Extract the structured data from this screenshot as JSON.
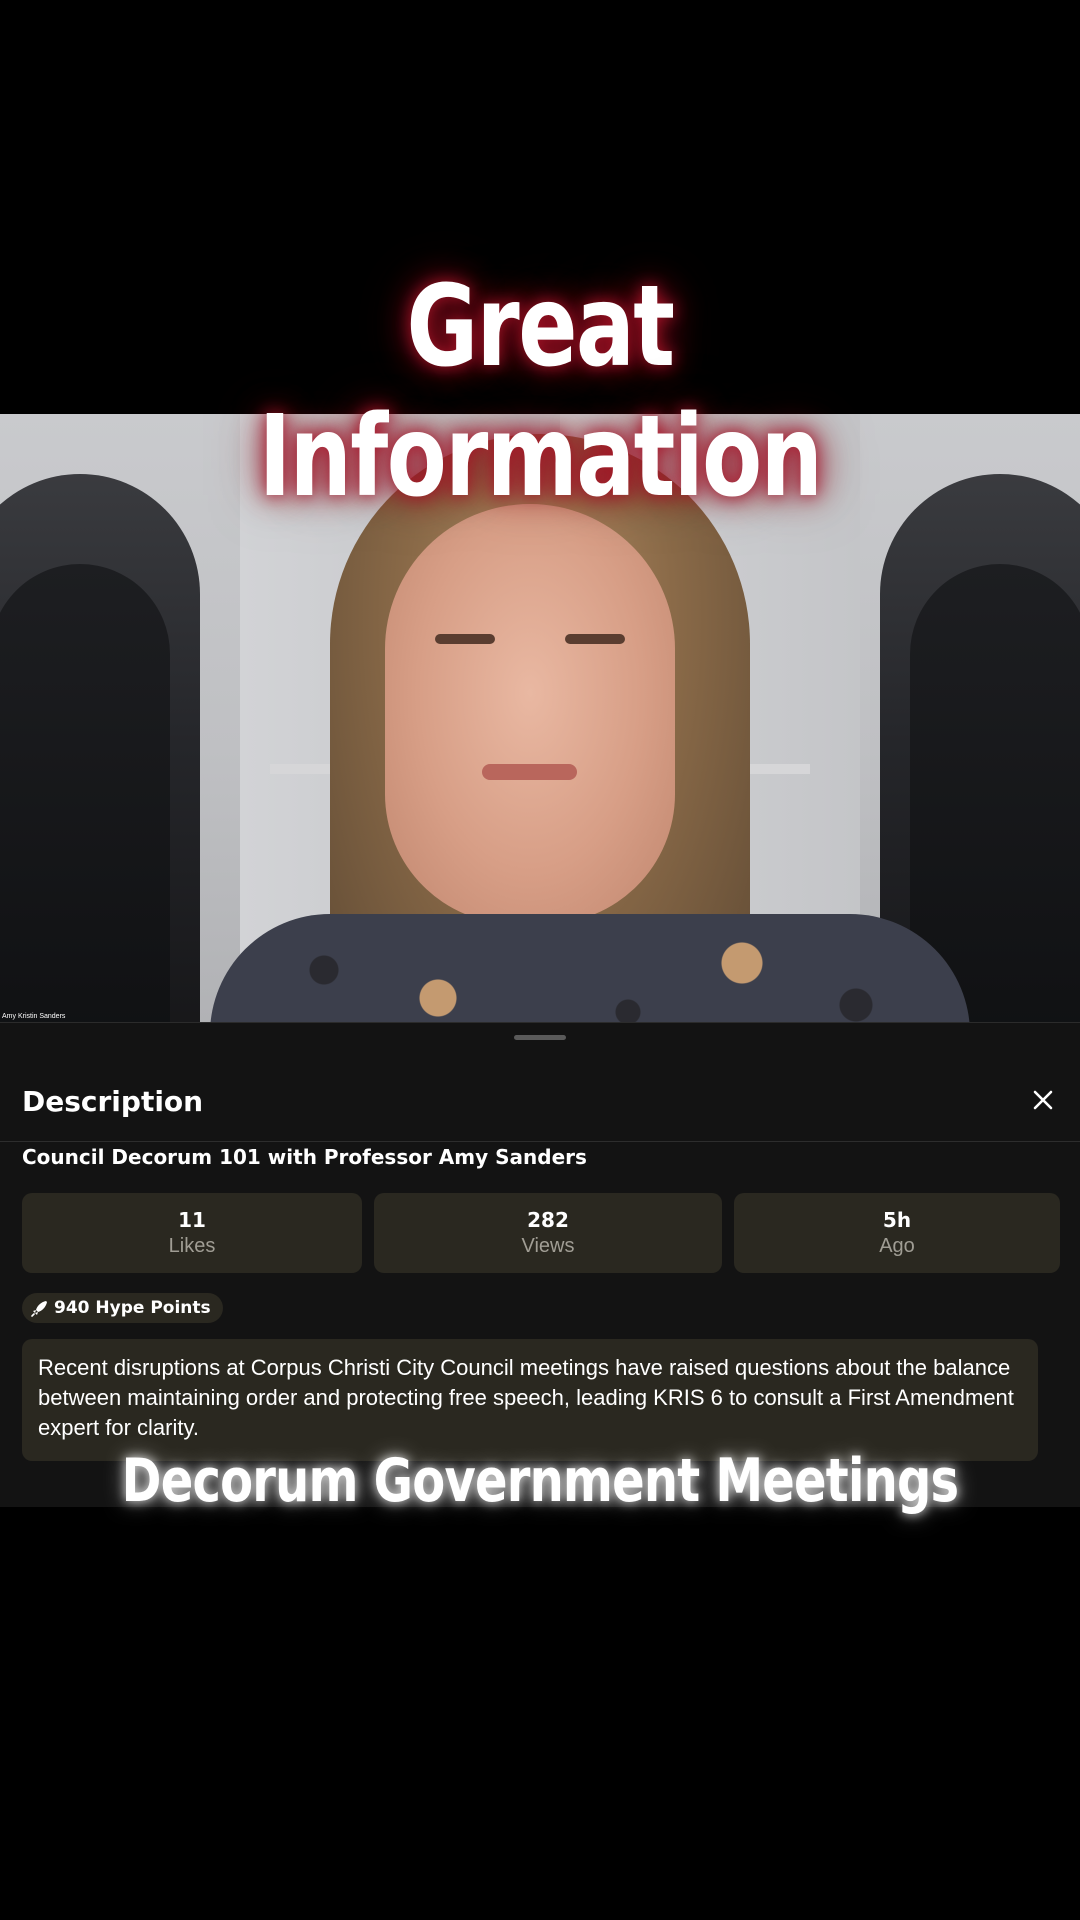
{
  "overlay": {
    "top_title": "Great Information",
    "bottom_caption": "Decorum Government Meetings"
  },
  "video": {
    "participant_name": "Amy Kristin Sanders"
  },
  "description_sheet": {
    "title": "Description",
    "close_icon": "close-icon",
    "video_title": "Council Decorum 101 with Professor Amy Sanders",
    "stats": [
      {
        "value": "11",
        "label": "Likes"
      },
      {
        "value": "282",
        "label": "Views"
      },
      {
        "value": "5h",
        "label": "Ago"
      }
    ],
    "hype": {
      "icon": "rocket-icon",
      "text": "940 Hype Points"
    },
    "description_text": "Recent disruptions at Corpus Christi City Council meetings have raised questions about the balance between maintaining order and protecting free speech, leading KRIS 6 to consult a First Amendment expert for clarity."
  },
  "colors": {
    "background": "#000000",
    "sheet_background": "#131313",
    "card_background": "#2a2820",
    "title_glow": "#8c0a1e",
    "muted_label": "#a09d94"
  }
}
